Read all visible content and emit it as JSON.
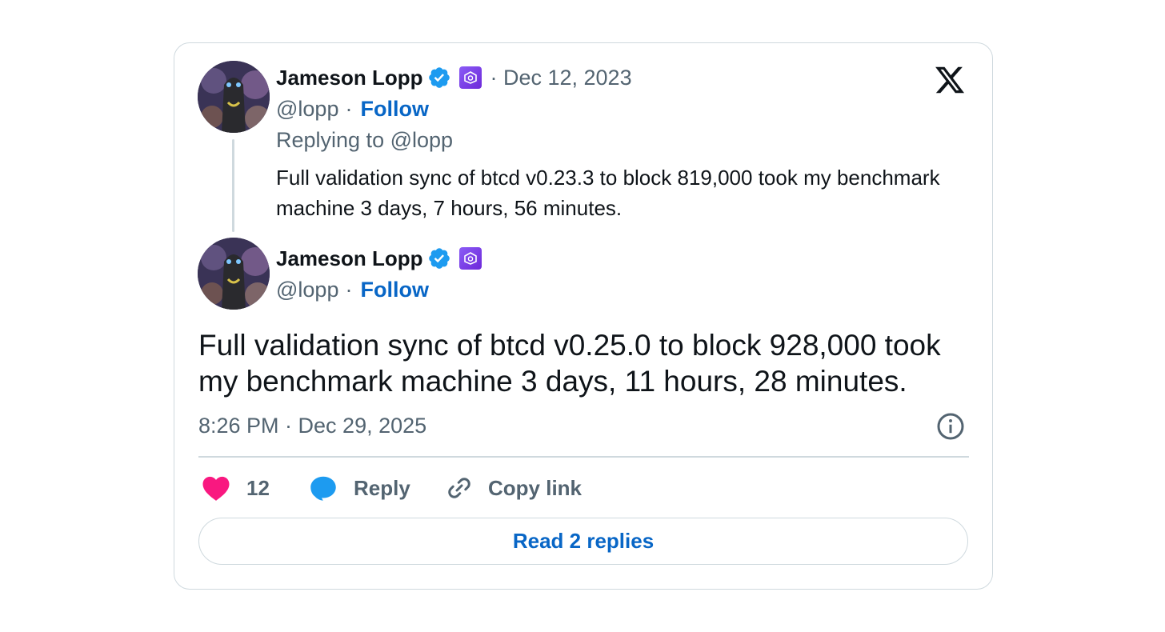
{
  "quoted_tweet": {
    "author_name": "Jameson Lopp",
    "handle": "@lopp",
    "separator": "·",
    "follow_label": "Follow",
    "date": "· Dec 12, 2023",
    "replying_to": "Replying to @lopp",
    "text": "Full validation sync of btcd v0.23.3 to block 819,000 took my benchmark machine 3 days, 7 hours, 56 minutes."
  },
  "main_tweet": {
    "author_name": "Jameson Lopp",
    "handle": "@lopp",
    "separator": "·",
    "follow_label": "Follow",
    "text": "Full validation sync of btcd v0.25.0 to block 928,000 took my benchmark machine 3 days, 11 hours, 28 minutes.",
    "timestamp": "8:26 PM · Dec 29, 2025"
  },
  "actions": {
    "like_count": "12",
    "reply_label": "Reply",
    "copy_link_label": "Copy link"
  },
  "read_replies_label": "Read 2 replies",
  "icons": {
    "brand": "x-logo-icon",
    "verified": "verified-badge-icon",
    "affiliate": "affiliate-badge-icon",
    "like": "heart-icon",
    "reply": "speech-bubble-icon",
    "copy_link": "link-icon",
    "info": "info-icon"
  },
  "colors": {
    "verified_blue": "#1d9bf0",
    "heart_pink": "#f91880",
    "link_blue": "#0866c6",
    "secondary_text": "#536471",
    "border": "#cfd9de"
  }
}
